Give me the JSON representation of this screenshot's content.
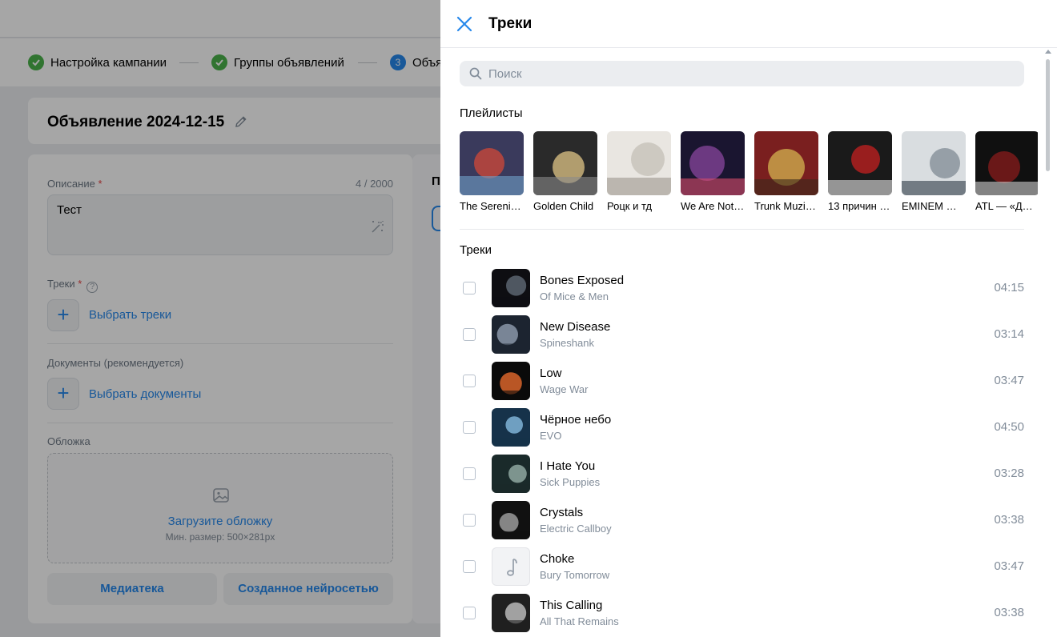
{
  "background": {
    "steps": [
      {
        "label": "Настройка кампании",
        "state": "done"
      },
      {
        "label": "Группы объявлений",
        "state": "done"
      },
      {
        "label": "Объя",
        "number": "3",
        "state": "active"
      }
    ],
    "ad_title": "Объявление 2024-12-15",
    "description_label": "Описание",
    "required_mark": "*",
    "description_counter": "4 / 2000",
    "description_value": "Тест",
    "tracks_label": "Треки",
    "help_mark": "?",
    "plus_glyph": "+",
    "choose_tracks": "Выбрать треки",
    "documents_label": "Документы (рекомендуется)",
    "choose_documents": "Выбрать документы",
    "cover_label": "Обложка",
    "upload_cover": "Загрузите обложку",
    "upload_hint": "Мин. размер: 500×281px",
    "media_library_button": "Медиатека",
    "ai_generated_button": "Созданное нейросетью",
    "right_column_label": "П"
  },
  "panel": {
    "title": "Треки",
    "search_placeholder": "Поиск",
    "playlists_title": "Плейлисты",
    "tracks_title": "Треки",
    "playlists": [
      {
        "name": "The Serenity of Suffering",
        "display": "The Serenit…",
        "colors": [
          "#3a3a5c",
          "#c0473b",
          "#6fa0c8"
        ]
      },
      {
        "name": "Golden Child",
        "display": "Golden Child",
        "colors": [
          "#2a2a2a",
          "#c9b27a",
          "#8a8a8a"
        ]
      },
      {
        "name": "Роцк и тд",
        "display": "Роцк и тд",
        "colors": [
          "#e9e6e1",
          "#c8c3bb",
          "#9c968e"
        ]
      },
      {
        "name": "We Are Not Your Kind",
        "display": "We Are Not…",
        "colors": [
          "#1a1530",
          "#7b3f8f",
          "#d94c6b"
        ]
      },
      {
        "name": "Trunk Muzik",
        "display": "Trunk Muzik…",
        "colors": [
          "#7a1f1f",
          "#c9a24a",
          "#3b2a1a"
        ]
      },
      {
        "name": "13 причин",
        "display": "13 причин …",
        "colors": [
          "#1a1a1a",
          "#b02020",
          "#e8e8e8"
        ]
      },
      {
        "name": "EMINEM — Kamikaze",
        "display": "EMINEM — …",
        "colors": [
          "#d9dde0",
          "#8a949c",
          "#2d3a44"
        ]
      },
      {
        "name": "ATL — «ДИСКОТЕКА»",
        "display": "ATL — «ДИ…",
        "colors": [
          "#101010",
          "#7a1a1a",
          "#d0d0d0"
        ]
      }
    ],
    "tracks": [
      {
        "title": "Bones Exposed",
        "artist": "Of Mice & Men",
        "duration": "04:15",
        "colors": [
          "#0e0e12",
          "#5a6470"
        ]
      },
      {
        "title": "New Disease",
        "artist": "Spineshank",
        "duration": "03:14",
        "colors": [
          "#1c2430",
          "#8a97a8"
        ]
      },
      {
        "title": "Low",
        "artist": "Wage War",
        "duration": "03:47",
        "colors": [
          "#0a0a0a",
          "#d8642a"
        ]
      },
      {
        "title": "Чёрное небо",
        "artist": "EVO",
        "duration": "04:50",
        "colors": [
          "#16324a",
          "#7fb3d6"
        ]
      },
      {
        "title": "I Hate You",
        "artist": "Sick Puppies",
        "duration": "03:28",
        "colors": [
          "#1a2a2a",
          "#8fa7a0"
        ]
      },
      {
        "title": "Crystals",
        "artist": "Electric Callboy",
        "duration": "03:38",
        "colors": [
          "#111111",
          "#9a9a9a"
        ]
      },
      {
        "title": "Choke",
        "artist": "Bury Tomorrow",
        "duration": "03:47",
        "placeholder": true,
        "colors": [
          "#f2f3f5",
          "#99a2ad"
        ]
      },
      {
        "title": "This Calling",
        "artist": "All That Remains",
        "duration": "03:38",
        "colors": [
          "#202020",
          "#b8b8b8"
        ]
      }
    ],
    "colors": {
      "accent": "#2688eb",
      "secondary_text": "#818c99"
    }
  }
}
